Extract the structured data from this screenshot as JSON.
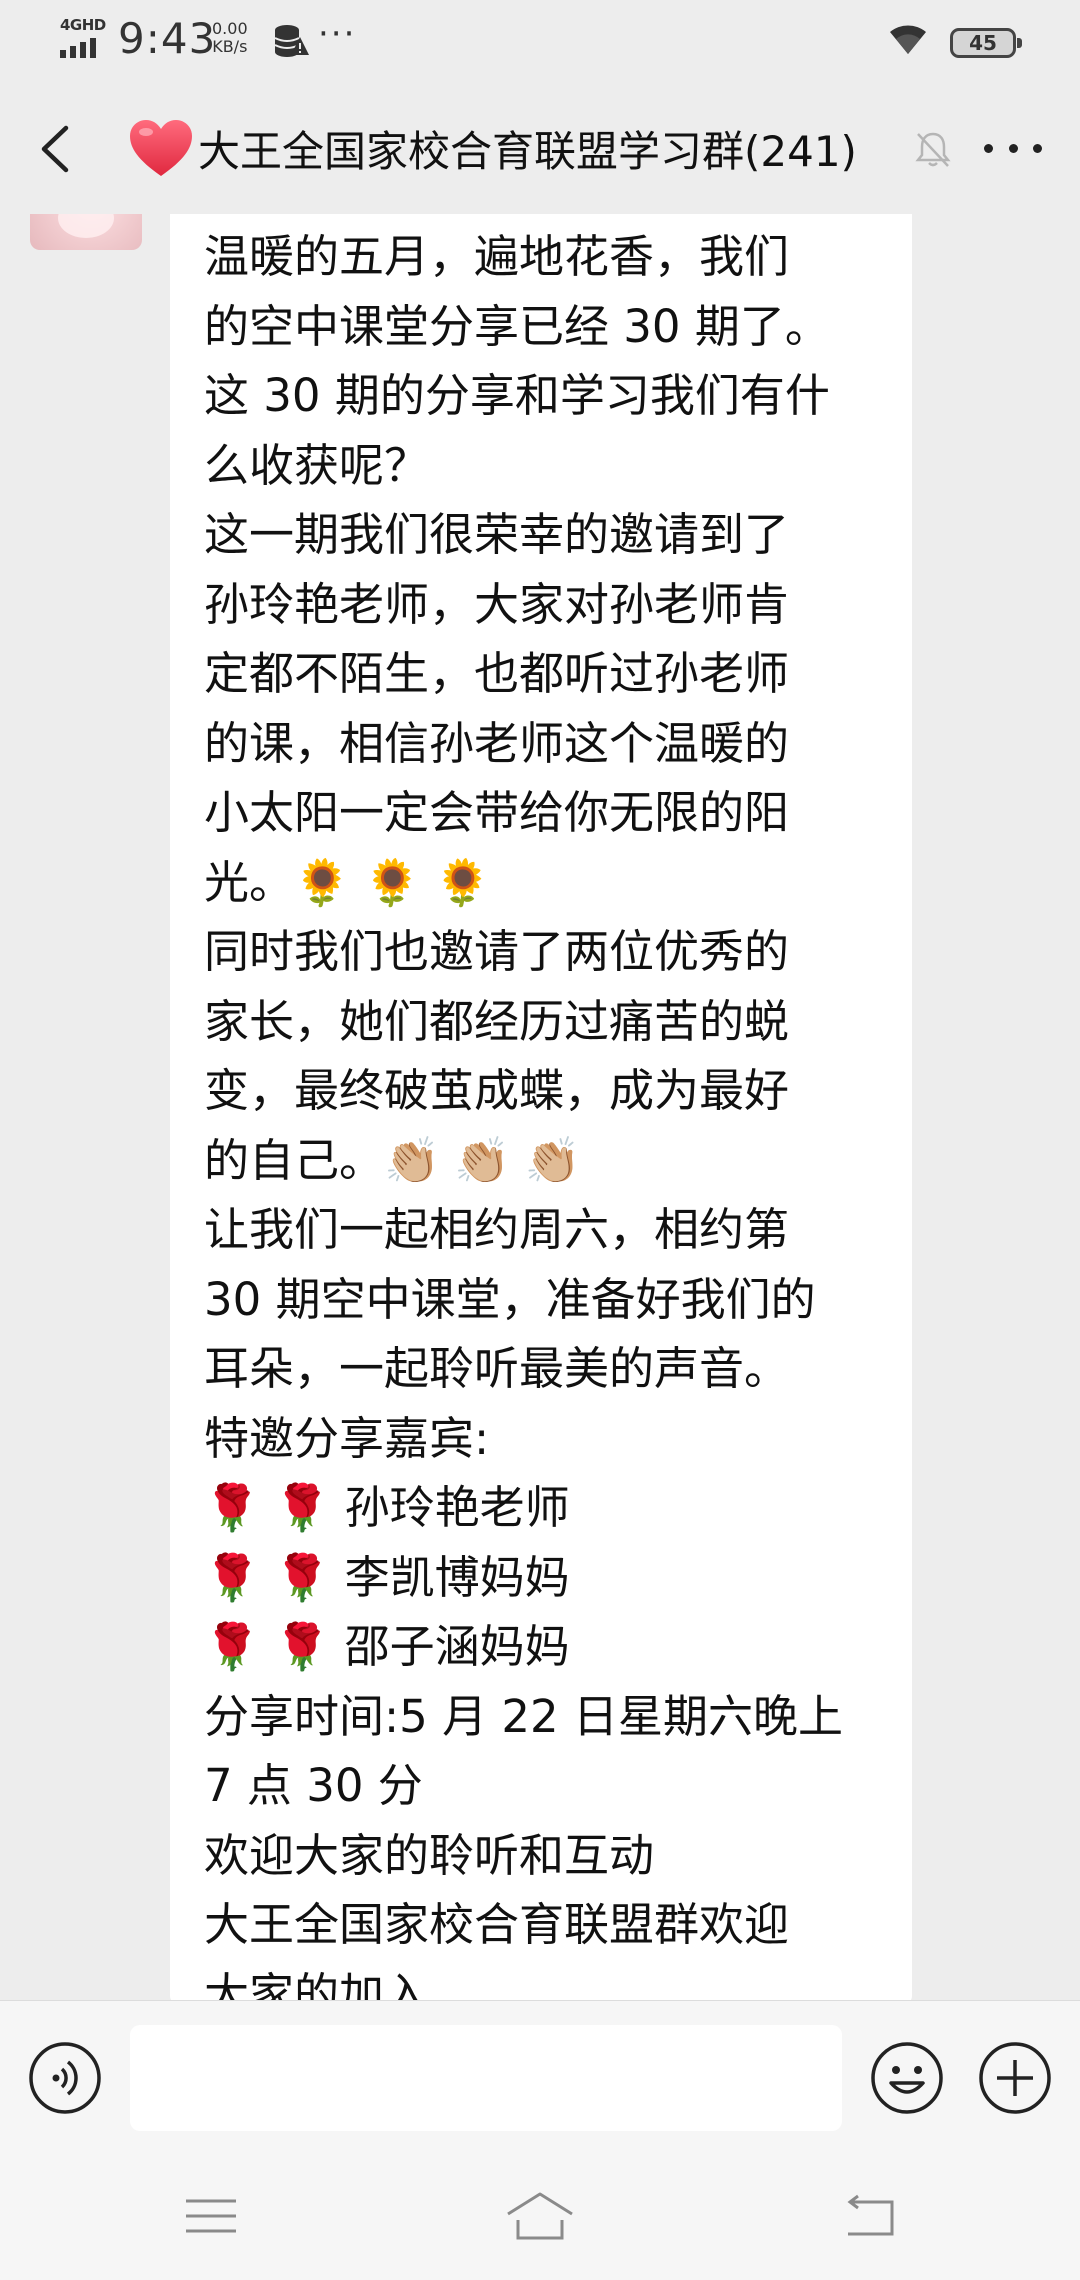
{
  "status_bar": {
    "network": "4GHD",
    "time": "9:43",
    "speed_value": "0.00",
    "speed_unit": "KB/s",
    "battery": "45",
    "icons": [
      "signal-icon",
      "data-saver-icon",
      "warning-icon",
      "more-notifications-icon",
      "wifi-icon",
      "battery-icon"
    ]
  },
  "header": {
    "title": "大王全国家校合育联盟学习群(241)",
    "icons": [
      "back-icon",
      "heart-icon",
      "mute-icon",
      "more-icon"
    ],
    "colors": {
      "heart": "#f0455a"
    }
  },
  "message": {
    "text": "温暖的五月，遍地花香，我们\n的空中课堂分享已经 30 期了。\n这 30 期的分享和学习我们有什\n么收获呢？\n这一期我们很荣幸的邀请到了\n孙玲艳老师，大家对孙老师肯\n定都不陌生，也都听过孙老师\n的课，相信孙老师这个温暖的\n小太阳一定会带给你无限的阳\n光。🌻 🌻 🌻\n同时我们也邀请了两位优秀的\n家长，她们都经历过痛苦的蜕\n变，最终破茧成蝶，成为最好\n的自己。👏🏼 👏🏼 👏🏼\n让我们一起相约周六，相约第\n30 期空中课堂，准备好我们的\n耳朵，一起聆听最美的声音。\n特邀分享嘉宾:\n🌹 🌹 孙玲艳老师\n🌹 🌹 李凯博妈妈\n🌹 🌹 邵子涵妈妈\n分享时间:5 月 22 日星期六晚上\n7 点 30 分\n欢迎大家的聆听和互动\n大王全国家校合育联盟群欢迎\n大家的加入"
  },
  "input_bar": {
    "placeholder": "",
    "icons": [
      "voice-icon",
      "emoji-icon",
      "plus-icon"
    ]
  },
  "nav_bar": {
    "icons": [
      "menu-icon",
      "home-icon",
      "back-nav-icon"
    ]
  },
  "colors": {
    "background": "#ededed",
    "bubble": "#ffffff",
    "text": "#111111"
  }
}
